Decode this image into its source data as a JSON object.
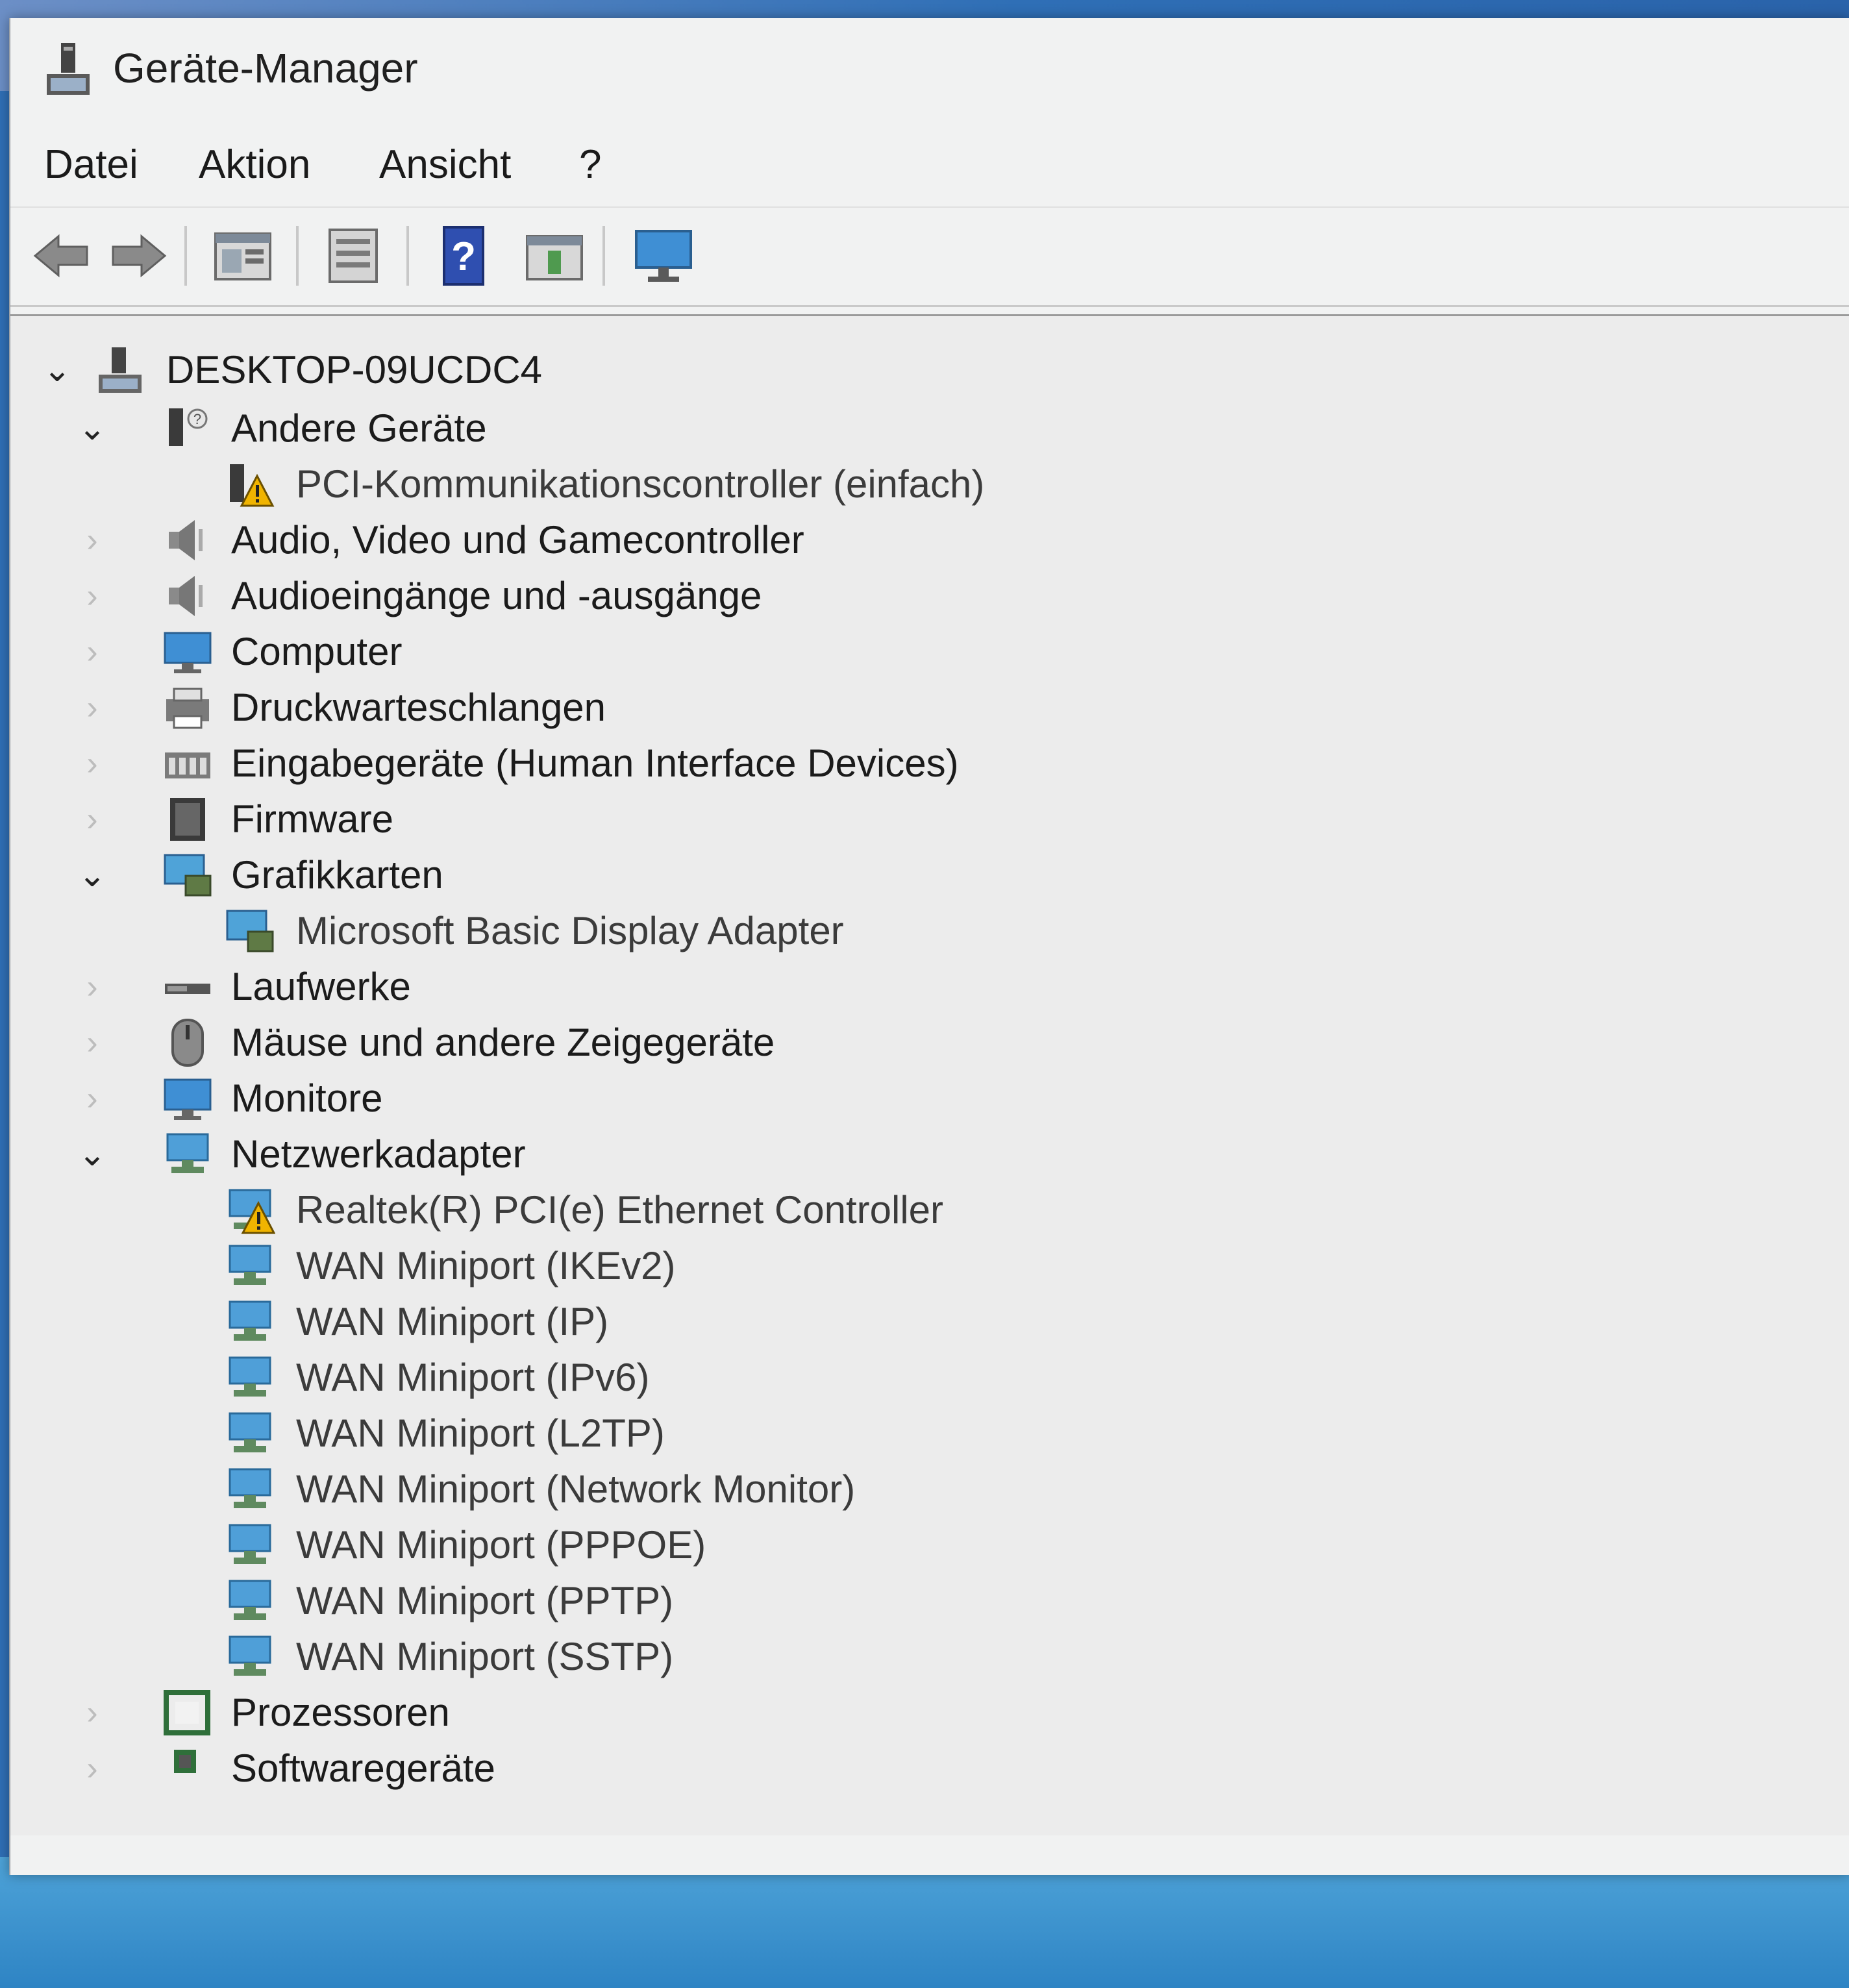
{
  "window": {
    "title": "Geräte-Manager"
  },
  "menu": [
    {
      "label": "Datei"
    },
    {
      "label": "Aktion"
    },
    {
      "label": "Ansicht"
    },
    {
      "label": "?"
    }
  ],
  "toolbar": [
    {
      "name": "back-icon"
    },
    {
      "name": "forward-icon"
    },
    {
      "name": "properties-icon"
    },
    {
      "name": "list-view-icon"
    },
    {
      "name": "help-icon"
    },
    {
      "name": "update-driver-icon"
    },
    {
      "name": "scan-hardware-icon"
    }
  ],
  "tree": {
    "root": {
      "label": "DESKTOP-09UCDC4",
      "expanded": true,
      "icon": "computer-tower-icon"
    },
    "items": [
      {
        "label": "Andere Geräte",
        "level": 1,
        "expanded": true,
        "icon": "unknown-device-icon"
      },
      {
        "label": "PCI-Kommunikationscontroller (einfach)",
        "level": 2,
        "icon": "warning-device-icon"
      },
      {
        "label": "Audio, Video und Gamecontroller",
        "level": 1,
        "expanded": false,
        "icon": "speaker-icon"
      },
      {
        "label": "Audioeingänge und -ausgänge",
        "level": 1,
        "expanded": false,
        "icon": "speaker-icon"
      },
      {
        "label": "Computer",
        "level": 1,
        "expanded": false,
        "icon": "monitor-icon"
      },
      {
        "label": "Druckwarteschlangen",
        "level": 1,
        "expanded": false,
        "icon": "printer-icon"
      },
      {
        "label": "Eingabegeräte (Human Interface Devices)",
        "level": 1,
        "expanded": false,
        "icon": "hid-icon"
      },
      {
        "label": "Firmware",
        "level": 1,
        "expanded": false,
        "icon": "chip-icon"
      },
      {
        "label": "Grafikkarten",
        "level": 1,
        "expanded": true,
        "icon": "display-adapter-icon"
      },
      {
        "label": "Microsoft Basic Display Adapter",
        "level": 2,
        "icon": "display-adapter-icon"
      },
      {
        "label": "Laufwerke",
        "level": 1,
        "expanded": false,
        "icon": "drive-icon"
      },
      {
        "label": "Mäuse und andere Zeigegeräte",
        "level": 1,
        "expanded": false,
        "icon": "mouse-icon"
      },
      {
        "label": "Monitore",
        "level": 1,
        "expanded": false,
        "icon": "monitor-icon"
      },
      {
        "label": "Netzwerkadapter",
        "level": 1,
        "expanded": true,
        "icon": "network-adapter-icon"
      },
      {
        "label": "Realtek(R) PCI(e) Ethernet Controller",
        "level": 2,
        "icon": "network-warning-icon"
      },
      {
        "label": "WAN Miniport (IKEv2)",
        "level": 2,
        "icon": "network-adapter-icon"
      },
      {
        "label": "WAN Miniport (IP)",
        "level": 2,
        "icon": "network-adapter-icon"
      },
      {
        "label": "WAN Miniport (IPv6)",
        "level": 2,
        "icon": "network-adapter-icon"
      },
      {
        "label": "WAN Miniport (L2TP)",
        "level": 2,
        "icon": "network-adapter-icon"
      },
      {
        "label": "WAN Miniport (Network Monitor)",
        "level": 2,
        "icon": "network-adapter-icon"
      },
      {
        "label": "WAN Miniport (PPPOE)",
        "level": 2,
        "icon": "network-adapter-icon"
      },
      {
        "label": "WAN Miniport (PPTP)",
        "level": 2,
        "icon": "network-adapter-icon"
      },
      {
        "label": "WAN Miniport (SSTP)",
        "level": 2,
        "icon": "network-adapter-icon"
      },
      {
        "label": "Prozessoren",
        "level": 1,
        "expanded": false,
        "icon": "processor-icon"
      },
      {
        "label": "Softwaregeräte",
        "level": 1,
        "expanded": false,
        "icon": "software-device-icon"
      }
    ]
  }
}
